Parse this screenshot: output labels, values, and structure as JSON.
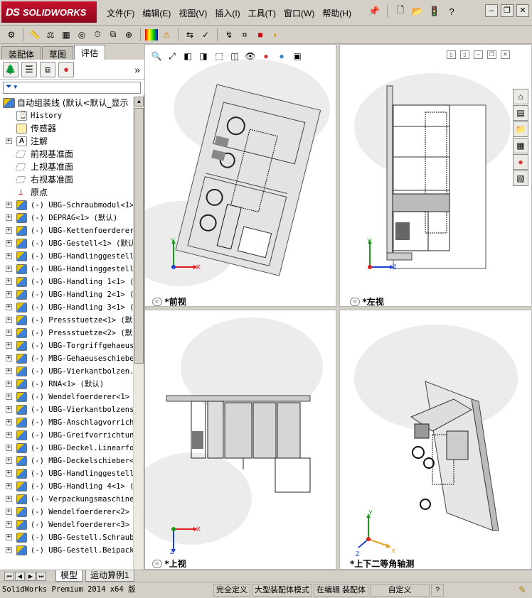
{
  "app": {
    "brand": "SOLIDWORKS",
    "menu": [
      "文件(F)",
      "编辑(E)",
      "视图(V)",
      "插入(I)",
      "工具(T)",
      "窗口(W)",
      "帮助(H)"
    ],
    "help_glyph": "?"
  },
  "panel": {
    "tabs": [
      "装配体",
      "草图",
      "评估"
    ],
    "active_tab": "评估",
    "filter_glyph": "▼",
    "expand_more": "»"
  },
  "tree": {
    "root": "自动组装线 (默认<默认_显示",
    "items": [
      {
        "label": "History",
        "icon": "history-icon",
        "expander": ""
      },
      {
        "label": "传感器",
        "icon": "sensor-icon",
        "expander": ""
      },
      {
        "label": "注解",
        "icon": "annotation-icon",
        "expander": "+"
      },
      {
        "label": "前视基准面",
        "icon": "plane-icon",
        "expander": ""
      },
      {
        "label": "上视基准面",
        "icon": "plane-icon",
        "expander": ""
      },
      {
        "label": "右视基准面",
        "icon": "plane-icon",
        "expander": ""
      },
      {
        "label": "原点",
        "icon": "origin-icon",
        "expander": ""
      },
      {
        "label": "(-) UBG-Schraubmodul<1>",
        "icon": "assembly-icon",
        "expander": "+"
      },
      {
        "label": "(-) DEPRAG<1> (默认)",
        "icon": "assembly-icon",
        "expander": "+"
      },
      {
        "label": "(-) UBG-Kettenfoerderer<",
        "icon": "assembly-icon",
        "expander": "+"
      },
      {
        "label": "(-) UBG-Gestell<1> (默认",
        "icon": "assembly-icon",
        "expander": "+"
      },
      {
        "label": "(-) UBG-Handlinggestell<",
        "icon": "assembly-icon",
        "expander": "+"
      },
      {
        "label": "(-) UBG-Handlinggestell<",
        "icon": "assembly-icon",
        "expander": "+"
      },
      {
        "label": "(-) UBG-Handling 1<1> (",
        "icon": "assembly-icon",
        "expander": "+"
      },
      {
        "label": "(-) UBG-Handling 2<1> (",
        "icon": "assembly-icon",
        "expander": "+"
      },
      {
        "label": "(-) UBG-Handling 3<1> (",
        "icon": "assembly-icon",
        "expander": "+"
      },
      {
        "label": "(-) Pressstuetze<1> (默认",
        "icon": "assembly-icon",
        "expander": "+"
      },
      {
        "label": "(-) Pressstuetze<2> (默认",
        "icon": "assembly-icon",
        "expander": "+"
      },
      {
        "label": "(-) UBG-Torgriffgehaeuse",
        "icon": "assembly-icon",
        "expander": "+"
      },
      {
        "label": "(-) MBG-Gehaeuseschieber",
        "icon": "assembly-icon",
        "expander": "+"
      },
      {
        "label": "(-) UBG-Vierkantbolzen.I",
        "icon": "assembly-icon",
        "expander": "+"
      },
      {
        "label": "(-) RNA<1> (默认)",
        "icon": "assembly-icon",
        "expander": "+"
      },
      {
        "label": "(-) Wendelfoerderer<1> (",
        "icon": "assembly-icon",
        "expander": "+"
      },
      {
        "label": "(-) UBG-Vierkantbolzensc",
        "icon": "assembly-icon",
        "expander": "+"
      },
      {
        "label": "(-) MBG-Anschlagvorricht",
        "icon": "assembly-icon",
        "expander": "+"
      },
      {
        "label": "(-) UBG-Greifvorrichtung",
        "icon": "assembly-icon",
        "expander": "+"
      },
      {
        "label": "(-) UBG-Deckel.Linearfoe",
        "icon": "assembly-icon",
        "expander": "+"
      },
      {
        "label": "(-) MBG-Deckelschieber<1",
        "icon": "assembly-icon",
        "expander": "+"
      },
      {
        "label": "(-) UBG-Handlinggestell<",
        "icon": "assembly-icon",
        "expander": "+"
      },
      {
        "label": "(-) UBG-Handling 4<1> (",
        "icon": "assembly-icon",
        "expander": "+"
      },
      {
        "label": "(-) Verpackungsmaschine.",
        "icon": "assembly-icon",
        "expander": "+"
      },
      {
        "label": "(-) Wendelfoerderer<2> (",
        "icon": "assembly-icon",
        "expander": "+"
      },
      {
        "label": "(-) Wendelfoerderer<3> (",
        "icon": "assembly-icon",
        "expander": "+"
      },
      {
        "label": "(-) UBG-Gestell.Schraubm",
        "icon": "assembly-icon",
        "expander": "+"
      },
      {
        "label": "(-) UBG-Gestell.Beipack<",
        "icon": "assembly-icon",
        "expander": "+"
      }
    ]
  },
  "viewports": {
    "front": {
      "label": "*前视",
      "axis_x": "X",
      "axis_y": "Y"
    },
    "left": {
      "label": "*左视",
      "axis_x": "Z",
      "axis_y": "Y"
    },
    "top": {
      "label": "*上视",
      "axis_x": "X",
      "axis_y": "Z"
    },
    "iso": {
      "label": "*上下二等角轴测",
      "axis_x": "X",
      "axis_y": "Y",
      "axis_z": "Z"
    }
  },
  "bottom_tabs": [
    "模型",
    "运动算例1"
  ],
  "status": {
    "product": "SolidWorks Premium 2014 x64 版",
    "definition": "完全定义",
    "mode": "大型装配体模式",
    "editing": "在编辑 装配体",
    "units": "自定义",
    "help": "?"
  },
  "colors": {
    "brand_red": "#c8102e",
    "axis_red": "#e02020",
    "axis_green": "#1a9a1a",
    "axis_blue": "#2040d0",
    "axis_orange": "#e0a020"
  }
}
